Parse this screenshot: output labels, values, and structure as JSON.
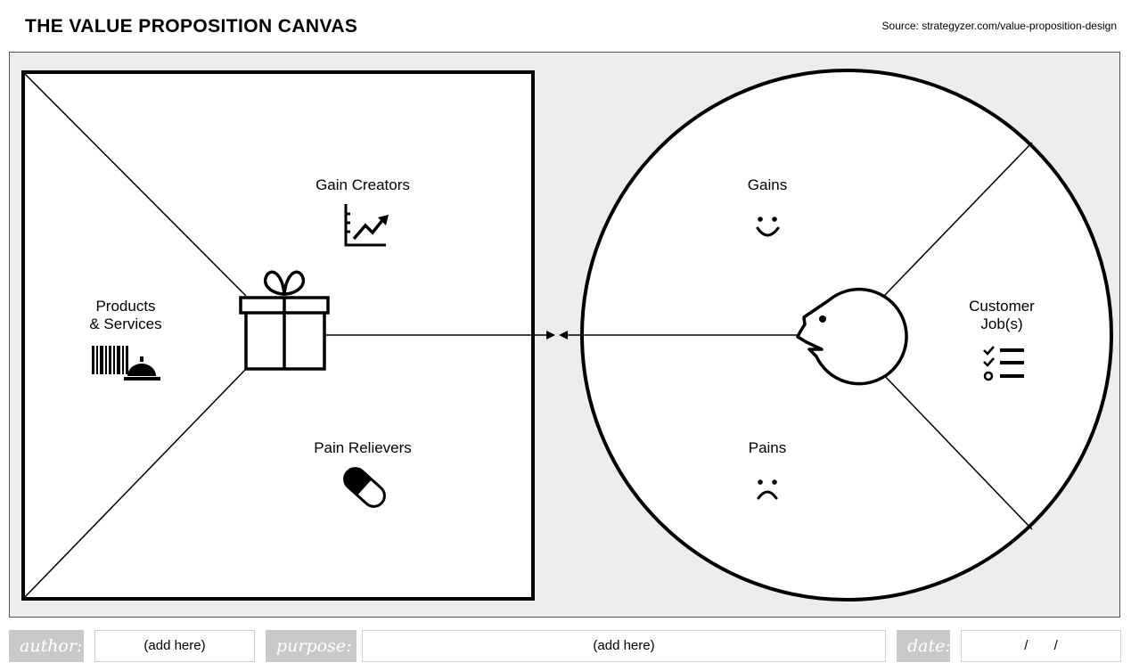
{
  "header": {
    "title": "THE VALUE PROPOSITION CANVAS",
    "source": "Source: strategyzer.com/value-proposition-design"
  },
  "value_map": {
    "products_services": "Products\n& Services",
    "gain_creators": "Gain Creators",
    "pain_relievers": "Pain Relievers"
  },
  "customer_profile": {
    "gains": "Gains",
    "pains": "Pains",
    "customer_jobs": "Customer\nJob(s)"
  },
  "icons": {
    "products": "barcode-bell-icon",
    "gain_creators": "rising-chart-icon",
    "pain_relievers": "pill-icon",
    "center_left": "gift-icon",
    "gains": "smiley-icon",
    "pains": "sad-face-icon",
    "jobs": "checklist-icon",
    "center_right": "customer-face-icon"
  },
  "footer": {
    "author_label": "author:",
    "author_value": "(add here)",
    "purpose_label": "purpose:",
    "purpose_value": "(add here)",
    "date_label": "date:",
    "date_value": "/       /"
  }
}
